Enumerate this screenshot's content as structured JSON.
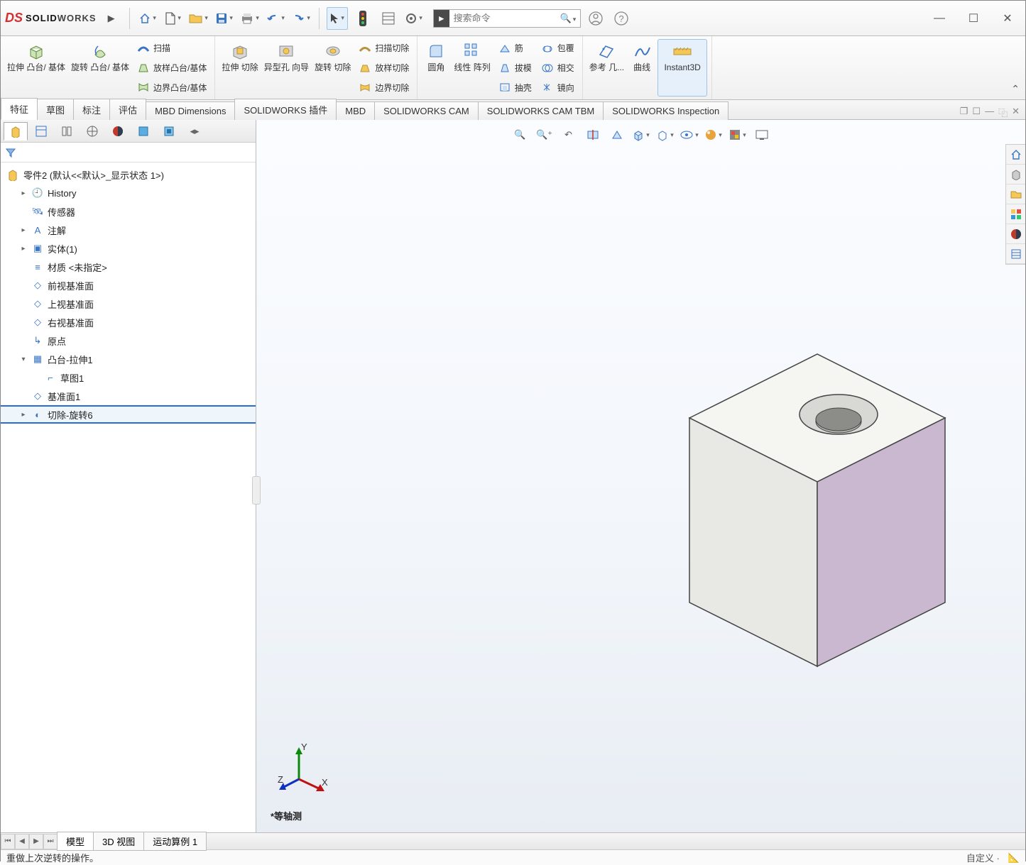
{
  "app": {
    "brand1": "DS",
    "brand2a": "SOLID",
    "brand2b": "WORKS"
  },
  "search": {
    "placeholder": "搜索命令"
  },
  "ribbon": {
    "grp1": {
      "b1": "拉伸\n凸台/\n基体",
      "b2": "旋转\n凸台/\n基体",
      "r1": "扫描",
      "r2": "放样凸台/基体",
      "r3": "边界凸台/基体"
    },
    "grp2": {
      "b1": "拉伸\n切除",
      "b2": "异型孔\n向导",
      "b3": "旋转\n切除",
      "r1": "扫描切除",
      "r2": "放样切除",
      "r3": "边界切除"
    },
    "grp3": {
      "b1": "圆角",
      "b2": "线性\n阵列",
      "r1": "筋",
      "r2": "拔模",
      "r3": "抽壳",
      "r4": "包覆",
      "r5": "相交",
      "r6": "镜向"
    },
    "grp4": {
      "b1": "参考\n几...",
      "b2": "曲线",
      "b3": "Instant3D"
    }
  },
  "tabs": [
    "特征",
    "草图",
    "标注",
    "评估",
    "MBD Dimensions",
    "SOLIDWORKS 插件",
    "MBD",
    "SOLIDWORKS CAM",
    "SOLIDWORKS CAM TBM",
    "SOLIDWORKS Inspection"
  ],
  "tree": {
    "root": "零件2  (默认<<默认>_显示状态 1>)",
    "items": [
      {
        "l": "History",
        "exp": "▸",
        "i": "clock",
        "d": 1
      },
      {
        "l": "传感器",
        "exp": "",
        "i": "sensor",
        "d": 1
      },
      {
        "l": "注解",
        "exp": "▸",
        "i": "note",
        "d": 1
      },
      {
        "l": "实体(1)",
        "exp": "▸",
        "i": "solid",
        "d": 1
      },
      {
        "l": "材质 <未指定>",
        "exp": "",
        "i": "mat",
        "d": 1
      },
      {
        "l": "前视基准面",
        "exp": "",
        "i": "plane",
        "d": 1
      },
      {
        "l": "上视基准面",
        "exp": "",
        "i": "plane",
        "d": 1
      },
      {
        "l": "右视基准面",
        "exp": "",
        "i": "plane",
        "d": 1
      },
      {
        "l": "原点",
        "exp": "",
        "i": "origin",
        "d": 1
      },
      {
        "l": "凸台-拉伸1",
        "exp": "▾",
        "i": "ext",
        "d": 1
      },
      {
        "l": "草图1",
        "exp": "",
        "i": "sk",
        "d": 2
      },
      {
        "l": "基准面1",
        "exp": "",
        "i": "plane",
        "d": 1
      },
      {
        "l": "切除-旋转6",
        "exp": "▸",
        "i": "rev",
        "d": 1,
        "hl": true
      }
    ]
  },
  "view": {
    "label": "*等轴测"
  },
  "bottom": {
    "tabs": [
      "模型",
      "3D 视图",
      "运动算例 1"
    ]
  },
  "status": {
    "msg": "重做上次逆转的操作。",
    "right": "自定义  ·"
  }
}
